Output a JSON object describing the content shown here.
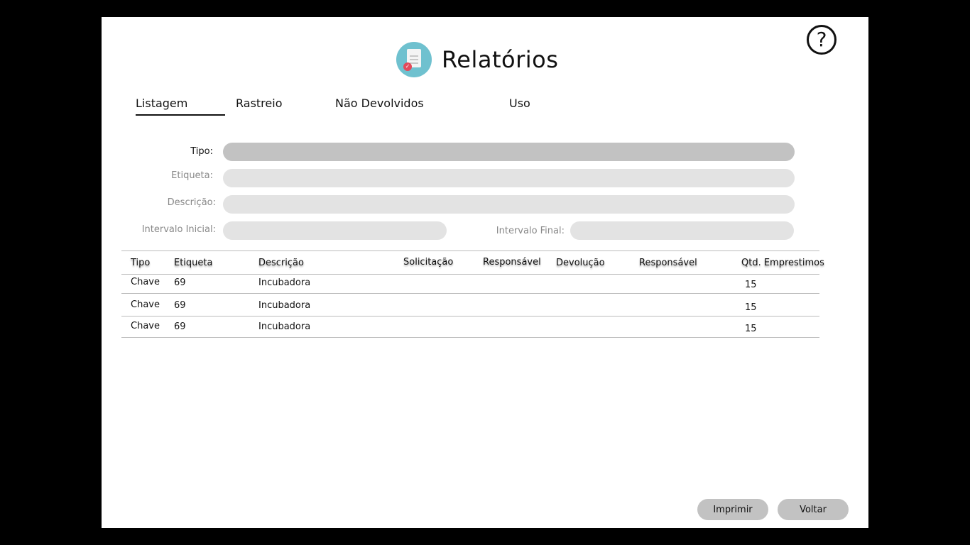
{
  "header": {
    "title": "Relatórios",
    "title_icon": "report-document-icon",
    "help_icon": "help-circle-icon",
    "help_glyph": "?"
  },
  "tabs": [
    {
      "label": "Listagem",
      "active": true
    },
    {
      "label": "Rastreio",
      "active": false
    },
    {
      "label": "Não Devolvidos",
      "active": false
    },
    {
      "label": "Uso",
      "active": false
    }
  ],
  "filters": {
    "tipo_label": "Tipo:",
    "etiqueta_label": "Etiqueta:",
    "descricao_label": "Descrição:",
    "intervalo_inicial_label": "Intervalo Inicial:",
    "intervalo_final_label": "Intervalo Final:"
  },
  "table": {
    "columns": [
      "Tipo",
      "Etiqueta",
      "Descrição",
      "Solicitação",
      "Responsável",
      "Devolução",
      "Responsável",
      "Qtd. Emprestimos"
    ],
    "rows": [
      [
        "Chave",
        "69",
        "Incubadora",
        "",
        "",
        "",
        "",
        "15"
      ],
      [
        "Chave",
        "69",
        "Incubadora",
        "",
        "",
        "",
        "",
        "15"
      ],
      [
        "Chave",
        "69",
        "Incubadora",
        "",
        "",
        "",
        "",
        "15"
      ]
    ]
  },
  "buttons": {
    "print_label": "Imprimir",
    "back_label": "Voltar"
  },
  "colors": {
    "field_active": "#c2c2c2",
    "field_inactive": "#e3e3e3",
    "icon_bg": "#6fc1cf",
    "icon_check": "#e34a5a"
  }
}
